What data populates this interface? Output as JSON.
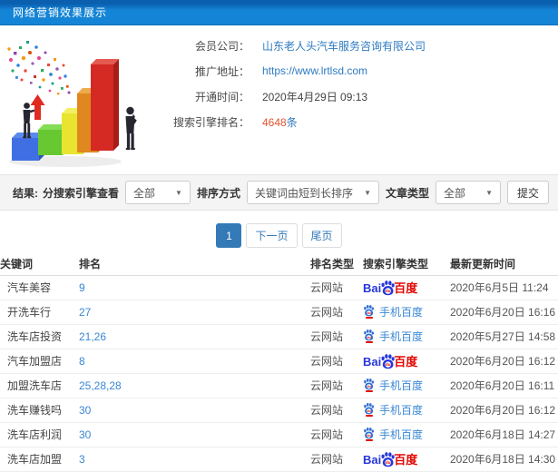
{
  "header": {
    "title": "网络营销效果展示"
  },
  "company": {
    "member_label": "会员公司：",
    "member_value": "山东老人头汽车服务咨询有限公司",
    "url_label": "推广地址：",
    "url_value": "https://www.lrtlsd.com",
    "opened_label": "开通时间：",
    "opened_value": "2020年4月29日 09:13",
    "rank_label": "搜索引擎排名：",
    "rank_count": "4648",
    "rank_unit": "条"
  },
  "filters": {
    "result_label": "结果:",
    "engine_view_label": "分搜索引擎查看",
    "engine_view_value": "全部",
    "sort_label": "排序方式",
    "sort_value": "关键词由短到长排序",
    "article_type_label": "文章类型",
    "article_type_value": "全部",
    "submit_label": "提交",
    "caret": "▼"
  },
  "pagination": {
    "current": "1",
    "next_label": "下一页",
    "last_label": "尾页"
  },
  "table": {
    "headers": [
      "关键词",
      "排名",
      "排名类型",
      "搜索引擎类型",
      "最新更新时间"
    ],
    "baidu_logo": {
      "left": "Bai",
      "du": "du",
      "right": "百度"
    },
    "mobile_baidu_label": "手机百度",
    "rows": [
      {
        "keyword": "汽车美容",
        "rank": "9",
        "rank_type": "云网站",
        "engine": "baidu",
        "time": "2020年6月5日 11:24"
      },
      {
        "keyword": "开洗车行",
        "rank": "27",
        "rank_type": "云网站",
        "engine": "mobile",
        "time": "2020年6月20日 16:16"
      },
      {
        "keyword": "洗车店投资",
        "rank": "21,26",
        "rank_type": "云网站",
        "engine": "mobile",
        "time": "2020年5月27日 14:58"
      },
      {
        "keyword": "汽车加盟店",
        "rank": "8",
        "rank_type": "云网站",
        "engine": "baidu",
        "time": "2020年6月20日 16:12"
      },
      {
        "keyword": "加盟洗车店",
        "rank": "25,28,28",
        "rank_type": "云网站",
        "engine": "mobile",
        "time": "2020年6月20日 16:11"
      },
      {
        "keyword": "洗车赚钱吗",
        "rank": "30",
        "rank_type": "云网站",
        "engine": "mobile",
        "time": "2020年6月20日 16:12"
      },
      {
        "keyword": "洗车店利润",
        "rank": "30",
        "rank_type": "云网站",
        "engine": "mobile",
        "time": "2020年6月18日 14:27"
      },
      {
        "keyword": "洗车店加盟",
        "rank": "3",
        "rank_type": "云网站",
        "engine": "baidu",
        "time": "2020年6月18日 14:30"
      }
    ]
  },
  "colors": {
    "header_bg": "#1484d6",
    "link_blue": "#2e7ac2",
    "rank_orange": "#e0532f",
    "pagination_active": "#337ab7",
    "baidu_blue": "#2636dc",
    "baidu_red": "#e10601"
  }
}
